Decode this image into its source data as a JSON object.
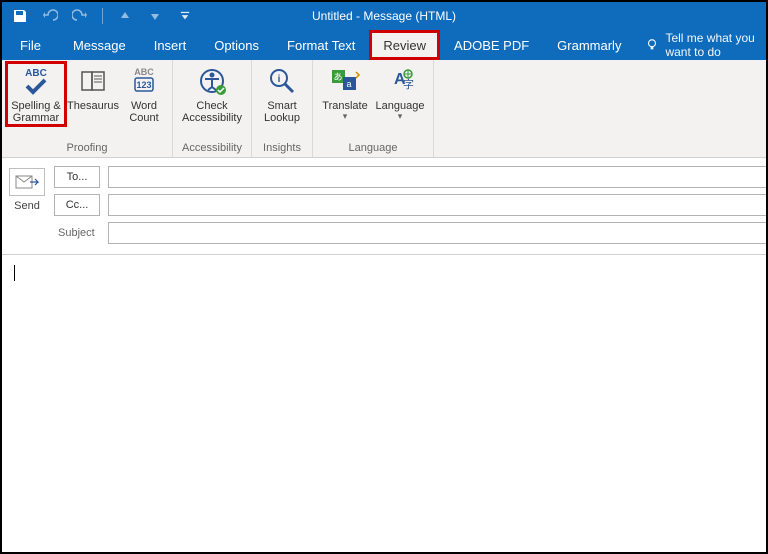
{
  "window": {
    "title": "Untitled  -  Message (HTML)"
  },
  "tabs": {
    "file": "File",
    "message": "Message",
    "insert": "Insert",
    "options": "Options",
    "format_text": "Format Text",
    "review": "Review",
    "adobe_pdf": "ADOBE PDF",
    "grammarly": "Grammarly",
    "tell_me": "Tell me what you want to do"
  },
  "ribbon": {
    "proofing": {
      "label": "Proofing",
      "spelling": "Spelling &\nGrammar",
      "thesaurus": "Thesaurus",
      "word_count": "Word\nCount"
    },
    "accessibility": {
      "label": "Accessibility",
      "check": "Check\nAccessibility"
    },
    "insights": {
      "label": "Insights",
      "smart_lookup": "Smart\nLookup"
    },
    "language": {
      "label": "Language",
      "translate": "Translate",
      "language": "Language"
    }
  },
  "compose": {
    "send": "Send",
    "to": "To...",
    "cc": "Cc...",
    "subject": "Subject",
    "to_value": "",
    "cc_value": "",
    "subject_value": "",
    "body": ""
  }
}
